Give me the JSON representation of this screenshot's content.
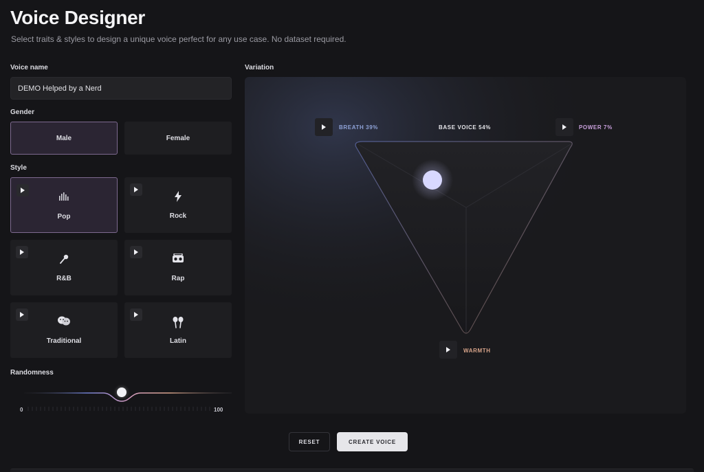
{
  "header": {
    "title": "Voice Designer",
    "subtitle": "Select traits & styles to design a unique voice perfect for any use case. No dataset required."
  },
  "voice_name": {
    "label": "Voice name",
    "value": "DEMO Helped by a Nerd"
  },
  "gender": {
    "label": "Gender",
    "options": [
      {
        "label": "Male",
        "selected": true
      },
      {
        "label": "Female",
        "selected": false
      }
    ]
  },
  "style": {
    "label": "Style",
    "items": [
      {
        "label": "Pop",
        "icon": "equalizer-icon",
        "selected": true
      },
      {
        "label": "Rock",
        "icon": "lightning-icon",
        "selected": false
      },
      {
        "label": "R&B",
        "icon": "microphone-icon",
        "selected": false
      },
      {
        "label": "Rap",
        "icon": "boombox-icon",
        "selected": false
      },
      {
        "label": "Traditional",
        "icon": "theater-masks-icon",
        "selected": false
      },
      {
        "label": "Latin",
        "icon": "maracas-icon",
        "selected": false
      }
    ]
  },
  "randomness": {
    "label": "Randomness",
    "min": "0",
    "max": "100",
    "value_fraction": 0.5
  },
  "variation": {
    "label": "Variation",
    "breath": "BREATH 39%",
    "base_voice": "BASE VOICE 54%",
    "power": "POWER 7%",
    "warmth": "WARMTH",
    "colors": {
      "breath": "#8fa3d8",
      "power": "#c9a0dc",
      "warmth": "#d8a48a"
    }
  },
  "actions": {
    "reset": "RESET",
    "create": "CREATE VOICE"
  }
}
